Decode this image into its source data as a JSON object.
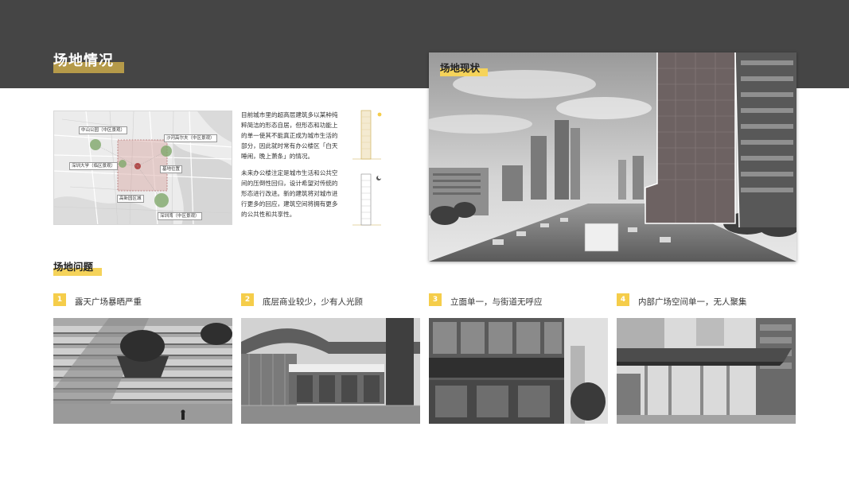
{
  "header": {
    "title": "场地情况"
  },
  "map": {
    "labels": {
      "zhongshan": "中山公园（中区景观）",
      "shahe": "沙河高尔夫（中区景观）",
      "szu": "深圳大学（临区景观）",
      "site": "基地位置",
      "hitech": "高新园区城",
      "bay": "深圳湾（中区景观）"
    }
  },
  "intro": {
    "p1": "目前城市里的超高层建筑多以某种纯粹简洁的形态自居，但形态和功能上的单一使其不能真正成为城市生活的部分，因此就时常有办公楼区「白天睡闹，晚上萧条」的情况。",
    "p2": "未来办公楼注定是城市生活和公共空间的压倒性回归，设计希望对传统的形态进行改进。新的建筑将对城市进行更多的回应，建筑空间将拥有更多的公共性和共享性。"
  },
  "current": {
    "label": "场地现状"
  },
  "issues": {
    "title": "场地问题",
    "items": [
      {
        "num": "1",
        "text": "露天广场暴晒严重"
      },
      {
        "num": "2",
        "text": "底层商业较少，少有人光顾"
      },
      {
        "num": "3",
        "text": "立面单一，与街道无呼应"
      },
      {
        "num": "4",
        "text": "内部广场空间单一，无人聚集"
      }
    ]
  },
  "colors": {
    "band": "#454545",
    "accent_gold": "#c9a94a",
    "accent_yellow": "#f5cd4a"
  }
}
